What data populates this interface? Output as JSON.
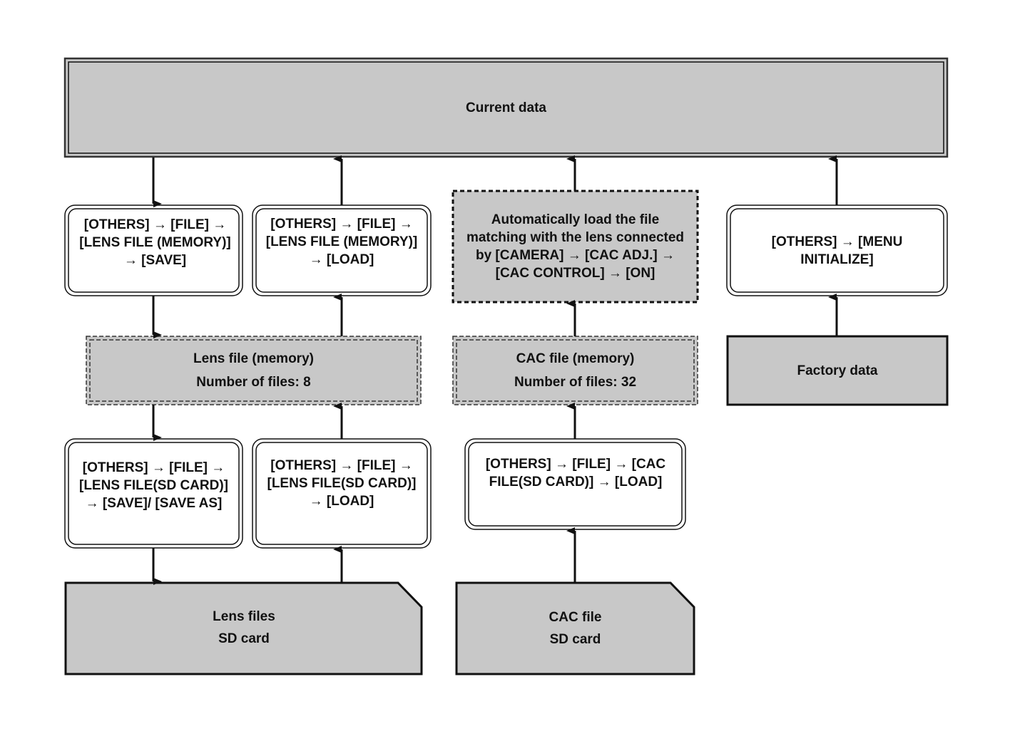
{
  "colors": {
    "box_fill_gray": "#c8c8c8",
    "box_fill_white": "#ffffff",
    "stroke": "#111111"
  },
  "nodes": {
    "current_data": {
      "label": "Current data"
    },
    "lens_mem_save": {
      "label": "[OTHERS] → [FILE] → [LENS FILE (MEMORY)] → [SAVE]"
    },
    "lens_mem_load": {
      "label": "[OTHERS] → [FILE] → [LENS FILE (MEMORY)] → [LOAD]"
    },
    "cac_auto_load": {
      "label": "Automatically load the file matching with the lens connected by [CAMERA] → [CAC ADJ.] → [CAC CONTROL] → [ON]"
    },
    "menu_initialize": {
      "label": "[OTHERS] → [MENU INITIALIZE]"
    },
    "lens_file_memory": {
      "line1": "Lens file (memory)",
      "line2": "Number of files: 8"
    },
    "cac_file_memory": {
      "line1": "CAC file (memory)",
      "line2": "Number of files: 32"
    },
    "factory_data": {
      "label": "Factory data"
    },
    "lens_sd_save": {
      "label": "[OTHERS] → [FILE] → [LENS FILE(SD CARD)] → [SAVE]/ [SAVE AS]"
    },
    "lens_sd_load": {
      "label": "[OTHERS] → [FILE] → [LENS FILE(SD CARD)] → [LOAD]"
    },
    "cac_sd_load": {
      "label": "[OTHERS] → [FILE] → [CAC FILE(SD CARD)] → [LOAD]"
    },
    "lens_files_sd": {
      "line1": "Lens files",
      "line2": "SD card"
    },
    "cac_file_sd": {
      "line1": "CAC file",
      "line2": "SD card"
    }
  },
  "edges": [
    {
      "from": "current_data",
      "to": "lens_mem_save"
    },
    {
      "from": "lens_mem_load",
      "to": "current_data"
    },
    {
      "from": "cac_auto_load",
      "to": "current_data"
    },
    {
      "from": "menu_initialize",
      "to": "current_data"
    },
    {
      "from": "lens_mem_save",
      "to": "lens_file_memory"
    },
    {
      "from": "lens_file_memory",
      "to": "lens_mem_load"
    },
    {
      "from": "cac_file_memory",
      "to": "cac_auto_load"
    },
    {
      "from": "factory_data",
      "to": "menu_initialize"
    },
    {
      "from": "lens_file_memory",
      "to": "lens_sd_save"
    },
    {
      "from": "lens_sd_load",
      "to": "lens_file_memory"
    },
    {
      "from": "cac_sd_load",
      "to": "cac_file_memory"
    },
    {
      "from": "lens_sd_save",
      "to": "lens_files_sd"
    },
    {
      "from": "lens_files_sd",
      "to": "lens_sd_load"
    },
    {
      "from": "cac_file_sd",
      "to": "cac_sd_load"
    }
  ]
}
